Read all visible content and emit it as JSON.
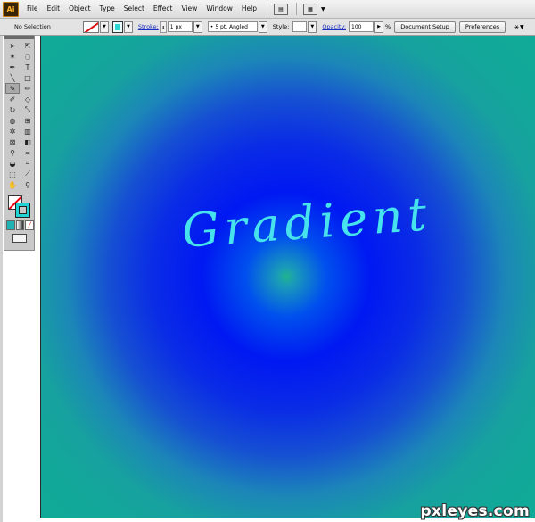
{
  "app": {
    "logo": "Ai"
  },
  "menu": [
    "File",
    "Edit",
    "Object",
    "Type",
    "Select",
    "Effect",
    "View",
    "Window",
    "Help"
  ],
  "control_bar": {
    "selection": "No Selection",
    "stroke_label": "Stroke:",
    "stroke_weight": "1 px",
    "brush": "5 pt. Angled",
    "style_label": "Style:",
    "opacity_label": "Opacity:",
    "opacity_value": "100",
    "opacity_unit": "%",
    "document_setup": "Document Setup",
    "preferences": "Preferences"
  },
  "canvas": {
    "text": "Gradient"
  },
  "watermark": "pxleyes.com",
  "colors": {
    "fill": "#22d3d3",
    "gradient_center": "#20b48d",
    "gradient_mid": "#0018f2",
    "gradient_outer": "#10aa98",
    "text": "#46e2ee"
  },
  "icons": [
    "arrange-documents-icon",
    "bridge-icon",
    "chevron-down-icon",
    "magic-wand-icon"
  ]
}
